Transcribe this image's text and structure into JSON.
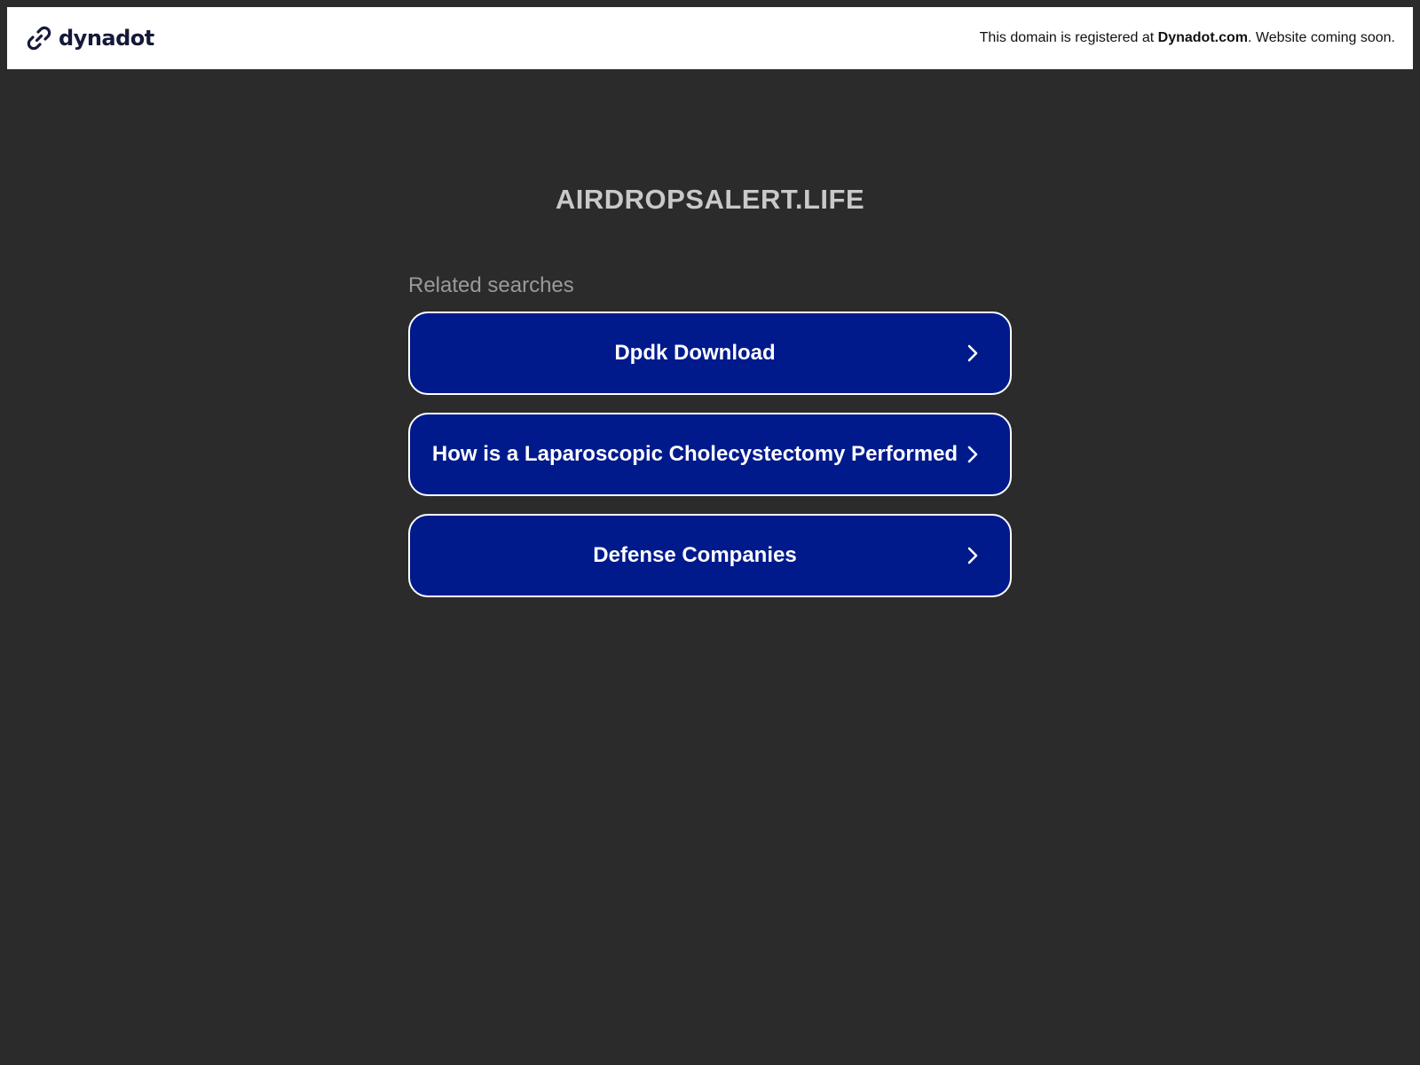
{
  "header": {
    "brand_name": "dynadot",
    "notice_prefix": "This domain is registered at ",
    "notice_link": "Dynadot.com",
    "notice_suffix": ". Website coming soon."
  },
  "domain": {
    "title": "AIRDROPSALERT.LIFE"
  },
  "related": {
    "label": "Related searches",
    "items": [
      {
        "label": "Dpdk Download"
      },
      {
        "label": "How is a Laparoscopic Cholecystectomy Performed"
      },
      {
        "label": "Defense Companies"
      }
    ]
  },
  "colors": {
    "background": "#2b2b2b",
    "button_blue": "#001a8c",
    "brand_navy": "#141a3a"
  },
  "icons": {
    "brand": "chain-link-icon",
    "chevron": "chevron-right-icon"
  }
}
